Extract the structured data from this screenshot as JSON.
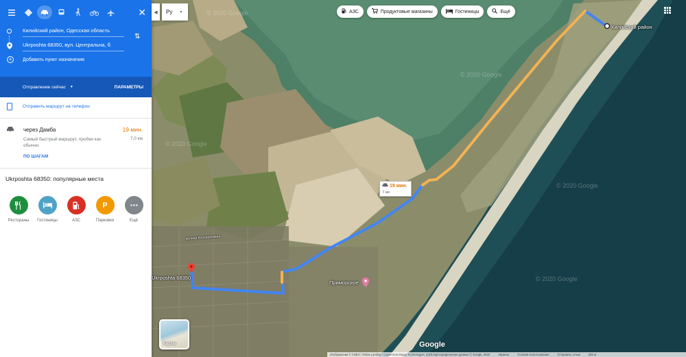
{
  "colors": {
    "accent": "#1a73e8",
    "route": "#4285f4",
    "traffic_slow": "#f4b350",
    "eta": "#e37400",
    "pin": "#ea4335"
  },
  "panel": {
    "modes": [
      {
        "icon": "menu-icon"
      },
      {
        "icon": "directions-icon"
      },
      {
        "icon": "car-icon"
      },
      {
        "icon": "transit-icon"
      },
      {
        "icon": "walk-icon"
      },
      {
        "icon": "bike-icon"
      },
      {
        "icon": "flight-icon"
      }
    ],
    "origin": "Килийский район, Одесская область",
    "destination": "Ukrposhta 68350, вул. Центральна, б",
    "add_destination": "Добавить пункт назначения",
    "depart_now": "Отправление сейчас",
    "options": "ПАРАМЕТРЫ",
    "send_to_phone": "Отправить маршрут на телефон",
    "route": {
      "via": "через Дамба",
      "time": "19 мин.",
      "description": "Самый быстрый маршрут, пробки как обычно",
      "distance": "7,0 км",
      "steps": "ПО ШАГАМ"
    },
    "popular_title": "Ukrposhta 68350: популярные места",
    "categories": [
      {
        "label": "Рестораны",
        "icon": "restaurant-icon",
        "color": "#1e8e3e"
      },
      {
        "label": "Гостиницы",
        "icon": "hotel-icon",
        "color": "#4fa3c4"
      },
      {
        "label": "АЗС",
        "icon": "gas-station-icon",
        "color": "#d93025"
      },
      {
        "label": "Парковки",
        "icon": "parking-icon",
        "color": "#f29900"
      },
      {
        "label": "Ещё",
        "icon": "more-icon",
        "color": "#80868b"
      }
    ]
  },
  "map": {
    "language": "Ру",
    "chips": [
      {
        "label": "АЗС",
        "icon": "gas-station-icon"
      },
      {
        "label": "Продуктовые магазины",
        "icon": "grocery-icon"
      },
      {
        "label": "Гостиницы",
        "icon": "hotel-icon"
      },
      {
        "label": "Ещё",
        "icon": "search-icon"
      }
    ],
    "eta_time": "19 мин.",
    "eta_distance": "7 км",
    "label_origin": "Килийский район",
    "label_destination": "Ukrposhta 68350",
    "label_town": "Приморское",
    "road_name": "вулиця Кооперативна",
    "watermark": "© 2020 Google",
    "layer_label": "Карты",
    "logo": "Google",
    "attribution": [
      "Изображения © CNES / Airbus,Landsat / Copernicus,Maxar Technologies, 2020,Картографические данные © Google, 2020",
      "Украина",
      "Условия использования",
      "Отправить отзыв",
      "500 м"
    ]
  }
}
